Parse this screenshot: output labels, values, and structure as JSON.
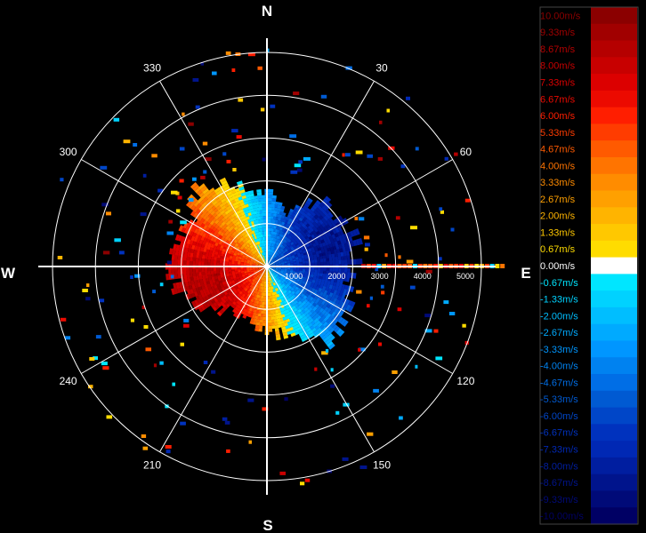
{
  "chart_data": {
    "type": "polar-radial-velocity",
    "cardinals": [
      "N",
      "E",
      "S",
      "W"
    ],
    "azimuth_labels": [
      {
        "deg": 30,
        "text": "30"
      },
      {
        "deg": 60,
        "text": "60"
      },
      {
        "deg": 120,
        "text": "120"
      },
      {
        "deg": 150,
        "text": "150"
      },
      {
        "deg": 210,
        "text": "210"
      },
      {
        "deg": 240,
        "text": "240"
      },
      {
        "deg": 300,
        "text": "300"
      },
      {
        "deg": 330,
        "text": "330"
      }
    ],
    "range_rings": [
      1000,
      2000,
      3000,
      4000,
      5000
    ],
    "range_labels": [
      "1000",
      "2000",
      "3000",
      "4000",
      "5000"
    ],
    "max_range": 5000,
    "colorbar": {
      "levels": [
        {
          "label": "10.00m/s",
          "color": "#8b0000"
        },
        {
          "label": "9.33m/s",
          "color": "#a10000"
        },
        {
          "label": "8.67m/s",
          "color": "#b50000"
        },
        {
          "label": "8.00m/s",
          "color": "#c80000"
        },
        {
          "label": "7.33m/s",
          "color": "#dc0000"
        },
        {
          "label": "6.67m/s",
          "color": "#ec0a00"
        },
        {
          "label": "6.00m/s",
          "color": "#ff1e00"
        },
        {
          "label": "5.33m/s",
          "color": "#ff3c00"
        },
        {
          "label": "4.67m/s",
          "color": "#ff5a00"
        },
        {
          "label": "4.00m/s",
          "color": "#ff7400"
        },
        {
          "label": "3.33m/s",
          "color": "#ff8c00"
        },
        {
          "label": "2.67m/s",
          "color": "#ffa000"
        },
        {
          "label": "2.00m/s",
          "color": "#ffb400"
        },
        {
          "label": "1.33m/s",
          "color": "#ffc800"
        },
        {
          "label": "0.67m/s",
          "color": "#ffdc00"
        },
        {
          "label": "0.00m/s",
          "color": "#ffffff"
        },
        {
          "label": "-0.67m/s",
          "color": "#00e6ff"
        },
        {
          "label": "-1.33m/s",
          "color": "#00d2ff"
        },
        {
          "label": "-2.00m/s",
          "color": "#00beff"
        },
        {
          "label": "-2.67m/s",
          "color": "#00aaff"
        },
        {
          "label": "-3.33m/s",
          "color": "#0096ff"
        },
        {
          "label": "-4.00m/s",
          "color": "#0082f0"
        },
        {
          "label": "-4.67m/s",
          "color": "#006ee6"
        },
        {
          "label": "-5.33m/s",
          "color": "#005ad2"
        },
        {
          "label": "-6.00m/s",
          "color": "#0046c8"
        },
        {
          "label": "-6.67m/s",
          "color": "#0032be"
        },
        {
          "label": "-7.33m/s",
          "color": "#0028b4"
        },
        {
          "label": "-8.00m/s",
          "color": "#001ea0"
        },
        {
          "label": "-8.67m/s",
          "color": "#00148c"
        },
        {
          "label": "-9.33m/s",
          "color": "#000a78"
        },
        {
          "label": "-10.00m/s",
          "color": "#000064"
        }
      ]
    },
    "velocity_field": {
      "wind_from_deg": 250,
      "peak_speed": 8.5,
      "profile": [
        {
          "az": 0,
          "range": 1700
        },
        {
          "az": 20,
          "range": 1300
        },
        {
          "az": 40,
          "range": 1900
        },
        {
          "az": 60,
          "range": 2000
        },
        {
          "az": 80,
          "range": 2100
        },
        {
          "az": 100,
          "range": 1900
        },
        {
          "az": 120,
          "range": 2200
        },
        {
          "az": 140,
          "range": 2300
        },
        {
          "az": 160,
          "range": 1700
        },
        {
          "az": 180,
          "range": 1400
        },
        {
          "az": 200,
          "range": 1300
        },
        {
          "az": 220,
          "range": 1300
        },
        {
          "az": 240,
          "range": 1800
        },
        {
          "az": 260,
          "range": 2200
        },
        {
          "az": 280,
          "range": 2200
        },
        {
          "az": 300,
          "range": 2100
        },
        {
          "az": 320,
          "range": 2500
        },
        {
          "az": 340,
          "range": 2000
        },
        {
          "az": 360,
          "range": 1700
        }
      ]
    }
  }
}
